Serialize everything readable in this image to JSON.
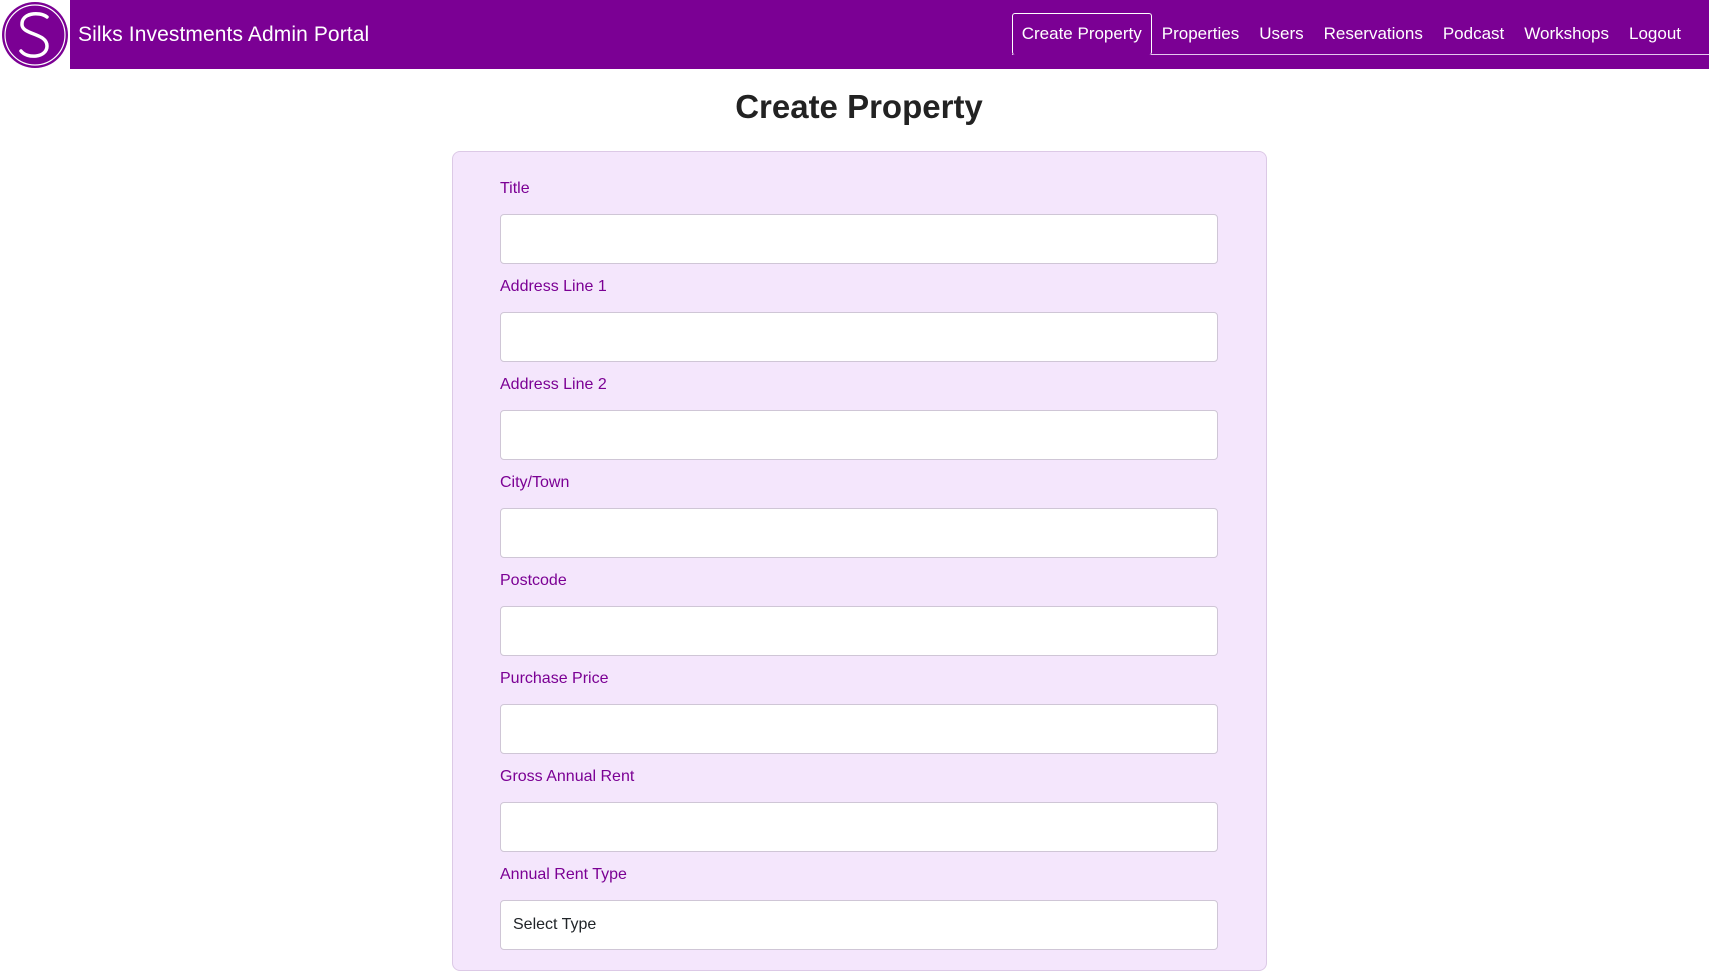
{
  "app": {
    "brand": "Silks Investments Admin Portal",
    "accent_color": "#7b0094",
    "logo_icon": "silks-s-logo"
  },
  "nav": {
    "items": [
      {
        "label": "Create Property",
        "active": true
      },
      {
        "label": "Properties"
      },
      {
        "label": "Users"
      },
      {
        "label": "Reservations"
      },
      {
        "label": "Podcast"
      },
      {
        "label": "Workshops"
      },
      {
        "label": "Logout"
      }
    ]
  },
  "page": {
    "title": "Create Property"
  },
  "form": {
    "fields": [
      {
        "label": "Title",
        "value": ""
      },
      {
        "label": "Address Line 1",
        "value": ""
      },
      {
        "label": "Address Line 2",
        "value": ""
      },
      {
        "label": "City/Town",
        "value": ""
      },
      {
        "label": "Postcode",
        "value": ""
      },
      {
        "label": "Purchase Price",
        "value": ""
      },
      {
        "label": "Gross Annual Rent",
        "value": ""
      }
    ],
    "rent_type": {
      "label": "Annual Rent Type",
      "selected": "Select Type"
    }
  }
}
